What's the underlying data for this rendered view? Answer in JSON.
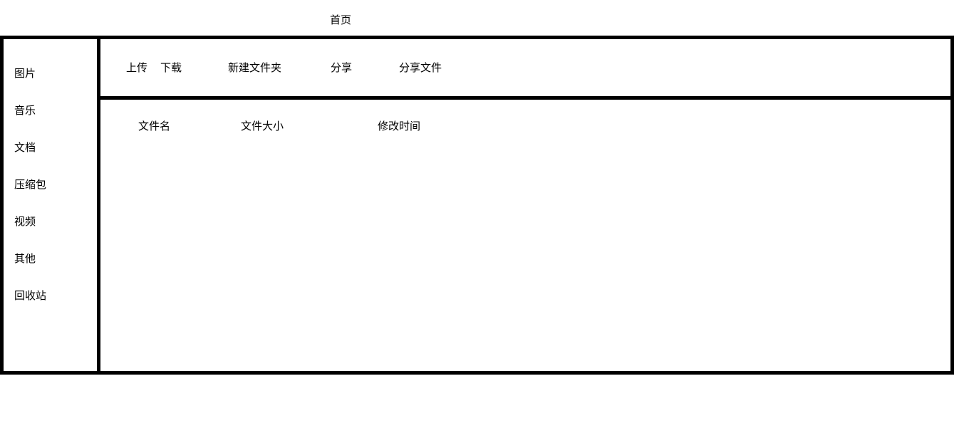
{
  "header": {
    "title": "首页"
  },
  "sidebar": {
    "items": [
      {
        "label": "图片"
      },
      {
        "label": "音乐"
      },
      {
        "label": "文档"
      },
      {
        "label": "压缩包"
      },
      {
        "label": "视频"
      },
      {
        "label": "其他"
      },
      {
        "label": "回收站"
      }
    ]
  },
  "toolbar": {
    "upload_label": "上传",
    "download_label": "下载",
    "new_folder_label": "新建文件夹",
    "share_label": "分享",
    "shared_files_label": "分享文件"
  },
  "file_list": {
    "columns": [
      "文件名",
      "文件大小",
      "修改时间"
    ]
  }
}
